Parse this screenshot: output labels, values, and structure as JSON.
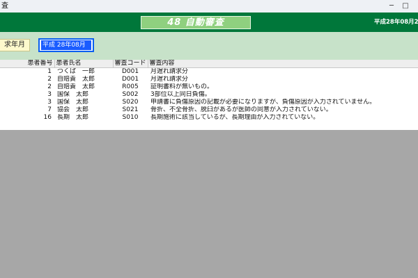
{
  "window": {
    "title": "査",
    "minimize": "─",
    "maximize": "□"
  },
  "header": {
    "banner": "48 自動審査",
    "date": "平成28年08月25"
  },
  "filter": {
    "label": "求年月",
    "value": "平成 28年08月"
  },
  "grid": {
    "columns": [
      "患者番号",
      "患者氏名",
      "審査コード",
      "審査内容"
    ],
    "rows": [
      {
        "no": "1",
        "name": "つくば　一郎",
        "code": "D001",
        "content": "月遅れ請求分"
      },
      {
        "no": "2",
        "name": "自賠責　太郎",
        "code": "D001",
        "content": "月遅れ請求分"
      },
      {
        "no": "2",
        "name": "自賠責　太郎",
        "code": "R005",
        "content": "証明書料が無いもの。"
      },
      {
        "no": "3",
        "name": "国保　太郎",
        "code": "S002",
        "content": "3部位以上同日負傷。"
      },
      {
        "no": "3",
        "name": "国保　太郎",
        "code": "S020",
        "content": "申請書に負傷原因の記載が必要になりますが、負傷原因が入力されていません。"
      },
      {
        "no": "7",
        "name": "協会　太郎",
        "code": "S021",
        "content": "骨折、不全骨折、脱臼があるが医師の同意が入力されていない。"
      },
      {
        "no": "16",
        "name": "長期　太郎",
        "code": "S010",
        "content": "長期施術に該当しているが、長期理由が入力されていない。"
      }
    ]
  }
}
